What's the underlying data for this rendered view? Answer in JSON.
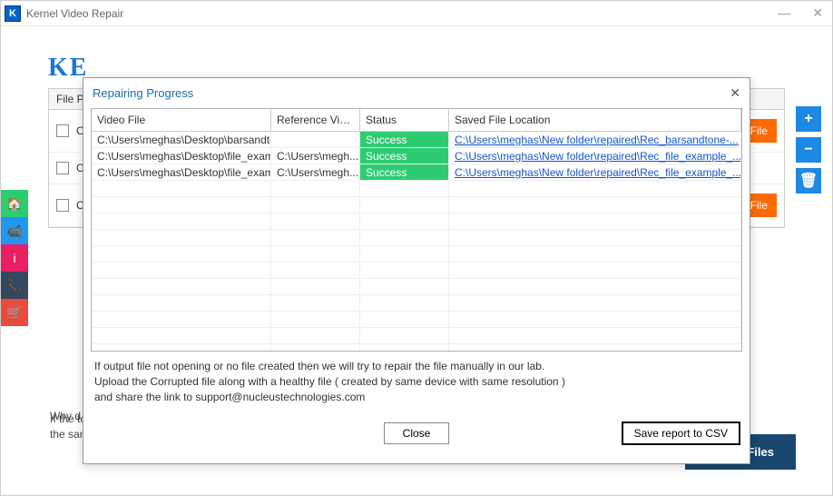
{
  "app": {
    "title": "Kernel Video Repair",
    "icon_letter": "K"
  },
  "brand_text": "KE",
  "file_panel": {
    "header": "File P",
    "rows": [
      {
        "label": "C:\\",
        "ref_btn": "ce File"
      },
      {
        "label": "C:\\",
        "ref_btn": ""
      },
      {
        "label": "C:\\",
        "ref_btn": "ce File"
      }
    ]
  },
  "right_toolbar": {
    "add": "+",
    "remove": "−",
    "delete": "🗑"
  },
  "sidebar_icons": {
    "home": "🏠",
    "video": "📹",
    "info": "i",
    "phone": "📞",
    "cart": "🛒"
  },
  "why_line": "Why d",
  "bottom_note": "If the tool is not able to identify the basic video structure, you need to add a healthy video file of the same type, same device and same configuration for reference.",
  "repair_btn": "Repair Files",
  "dialog": {
    "title": "Repairing Progress",
    "columns": {
      "video_file": "Video File",
      "reference": "Reference Video...",
      "status": "Status",
      "saved": "Saved File Location"
    },
    "rows": [
      {
        "video": "C:\\Users\\meghas\\Desktop\\barsandto...",
        "ref": "",
        "status": "Success",
        "saved": "C:\\Users\\meghas\\New folder\\repaired\\Rec_barsandtone-..."
      },
      {
        "video": "C:\\Users\\meghas\\Desktop\\file_exam...",
        "ref": "C:\\Users\\megh...",
        "status": "Success",
        "saved": "C:\\Users\\meghas\\New folder\\repaired\\Rec_file_example_..."
      },
      {
        "video": "C:\\Users\\meghas\\Desktop\\file_exam...",
        "ref": "C:\\Users\\megh...",
        "status": "Success",
        "saved": "C:\\Users\\meghas\\New folder\\repaired\\Rec_file_example_..."
      }
    ],
    "help_line1": "If output file not opening or no file created then we will try to repair the file manually in our lab.",
    "help_line2": "Upload the Corrupted file along with a healthy file ( created by same device with same resolution )",
    "help_line3": " and share the link to support@nucleustechnologies.com",
    "close_btn": "Close",
    "save_csv_btn": "Save report to CSV"
  }
}
